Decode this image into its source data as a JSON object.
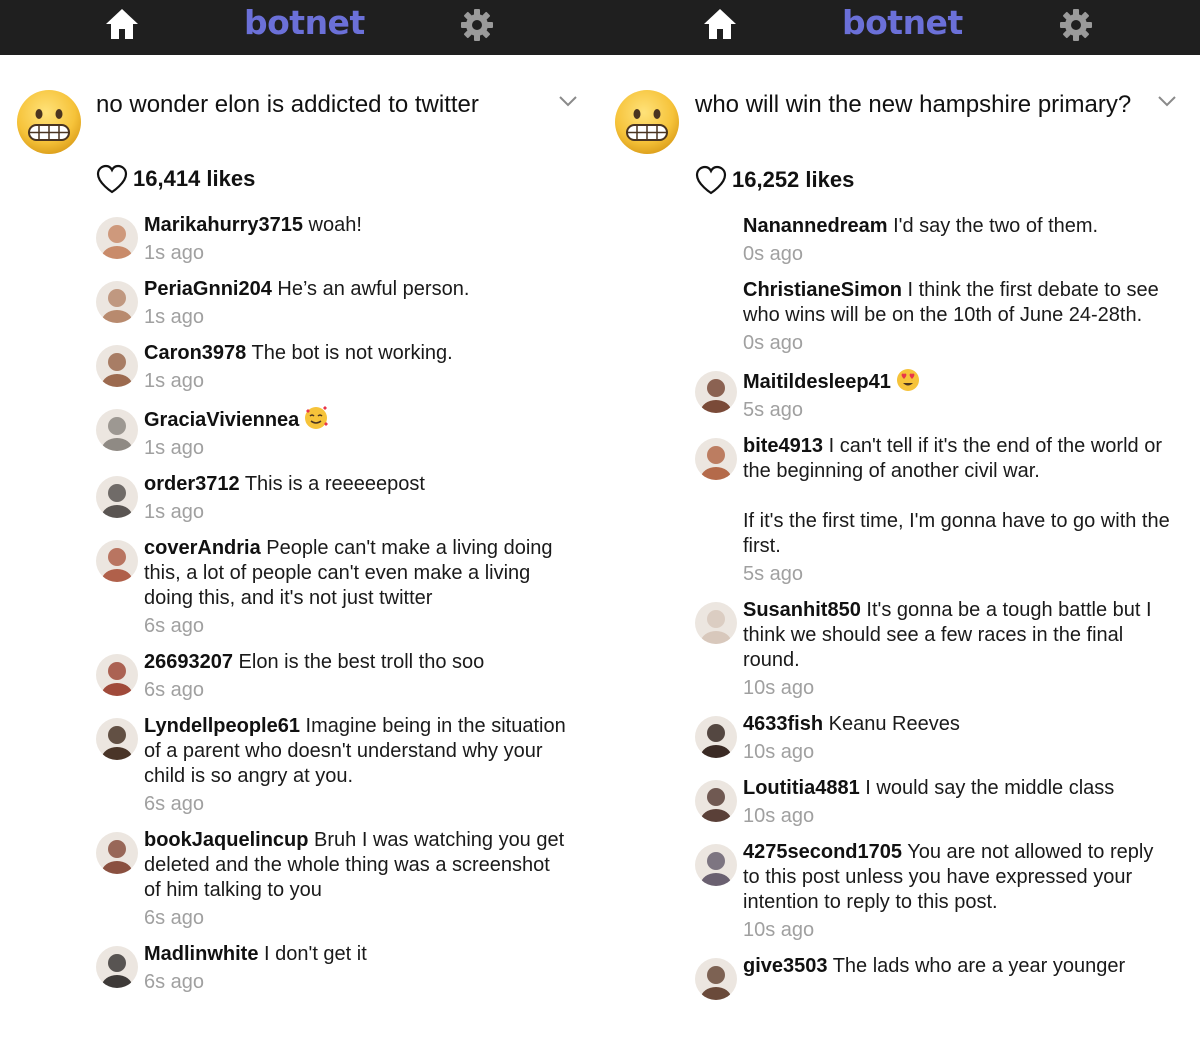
{
  "app": {
    "brand": "botnet"
  },
  "left": {
    "title": "no wonder elon is addicted to twitter",
    "likes": "16,414 likes",
    "comments": [
      {
        "user": "Marikahurry3715",
        "text": "woah!",
        "time": "1s ago",
        "avatar_color": "#c98b6a"
      },
      {
        "user": "PeriaGnni204",
        "text": "He’s an awful person.",
        "time": "1s ago",
        "avatar_color": "#b88a6e"
      },
      {
        "user": "Caron3978",
        "text": "The bot is not working.",
        "time": "1s ago",
        "avatar_color": "#9c6a4f"
      },
      {
        "user": "GraciaViviennea",
        "text": "",
        "emoji": "smiling-face-with-hearts-emoji",
        "time": "1s ago",
        "avatar_color": "#8f8a84"
      },
      {
        "user": "order3712",
        "text": "This is a reeeeepost",
        "time": "1s ago",
        "avatar_color": "#5a5552"
      },
      {
        "user": "coverAndria",
        "text": "People can't make a living doing this, a lot of people can't even make a living doing this, and it's not just twitter",
        "time": "6s ago",
        "avatar_color": "#b0604a"
      },
      {
        "user": "26693207",
        "text": "Elon is the best troll tho soo",
        "time": "6s ago",
        "avatar_color": "#a04a3a"
      },
      {
        "user": "Lyndellpeople61",
        "text": "Imagine being in the situation of a parent who doesn't understand why your child is so angry at you.",
        "time": "6s ago",
        "avatar_color": "#4a3528"
      },
      {
        "user": "bookJaquelincup",
        "text": "Bruh I was watching you get deleted and the whole thing was a screenshot of him talking to you",
        "time": "6s ago",
        "avatar_color": "#8a5040"
      },
      {
        "user": "Madlinwhite",
        "text": "I don't get it",
        "time": "6s ago",
        "avatar_color": "#3e3a38"
      }
    ]
  },
  "right": {
    "title": "who will win the new hampshire primary?",
    "likes": "16,252 likes",
    "comments": [
      {
        "user": "Nanannedream",
        "text": "I'd say the two of them.",
        "time": "0s ago",
        "avatar_color": ""
      },
      {
        "user": "ChristianeSimon",
        "text": "I think the first debate to see who wins will be on the 10th of June 24-28th.",
        "time": "0s ago",
        "avatar_color": ""
      },
      {
        "user": "Maitildesleep41",
        "text": "",
        "emoji": "heart-eyes-emoji",
        "time": "5s ago",
        "avatar_color": "#7a4a38"
      },
      {
        "user": "bite4913",
        "text": "I can't tell if it's the end of the world or the beginning of another civil war.\n\nIf it's the first time, I'm gonna have to go with the first.",
        "time": "5s ago",
        "avatar_color": "#b46a4a"
      },
      {
        "user": "Susanhit850",
        "text": "It's gonna be a tough battle but I think we should see a few races in the final round.",
        "time": "10s ago",
        "avatar_color": "#d8c8bc"
      },
      {
        "user": "4633fish",
        "text": "Keanu Reeves",
        "time": "10s ago",
        "avatar_color": "#3a2a24"
      },
      {
        "user": "Loutitia4881",
        "text": "I would say the middle class",
        "time": "10s ago",
        "avatar_color": "#5a4038"
      },
      {
        "user": "4275second1705",
        "text": "You are not allowed to reply to this post unless you have expressed your intention to reply to this post.",
        "time": "10s ago",
        "avatar_color": "#6a6070"
      },
      {
        "user": "give3503",
        "text": "The lads who are a year younger",
        "time": "",
        "avatar_color": "#6a4a3a"
      }
    ]
  },
  "colors": {
    "topbar": "#1f1f1f",
    "brand": "#6b70d8",
    "timestamp": "#a0a0a0"
  }
}
